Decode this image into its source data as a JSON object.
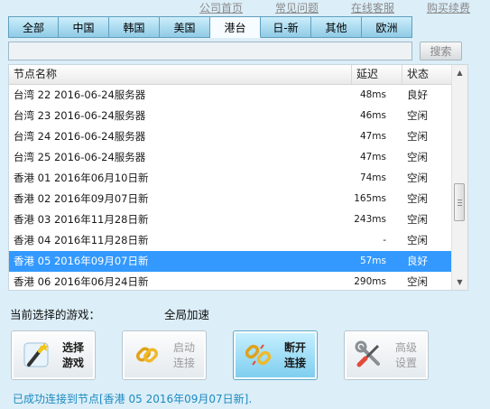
{
  "top_links": [
    "公司首页",
    "常见问题",
    "在线客服",
    "购买续费"
  ],
  "tabs": [
    "全部",
    "中国",
    "韩国",
    "美国",
    "港台",
    "日-新",
    "其他",
    "欧洲"
  ],
  "active_tab": 4,
  "search": {
    "value": "",
    "button": "搜索"
  },
  "list": {
    "headers": {
      "name": "节点名称",
      "ping": "延迟",
      "status": "状态"
    },
    "rows": [
      {
        "name": "台湾 22 2016-06-24服务器",
        "ping": "48ms",
        "status": "良好"
      },
      {
        "name": "台湾 23 2016-06-24服务器",
        "ping": "46ms",
        "status": "空闲"
      },
      {
        "name": "台湾 24 2016-06-24服务器",
        "ping": "47ms",
        "status": "空闲"
      },
      {
        "name": "台湾 25 2016-06-24服务器",
        "ping": "47ms",
        "status": "空闲"
      },
      {
        "name": "香港 01  2016年06月10日新",
        "ping": "74ms",
        "status": "空闲"
      },
      {
        "name": "香港 02 2016年09月07日新",
        "ping": "165ms",
        "status": "空闲"
      },
      {
        "name": "香港 03 2016年11月28日新",
        "ping": "243ms",
        "status": "空闲"
      },
      {
        "name": "香港 04 2016年11月28日新",
        "ping": "-",
        "status": "空闲"
      },
      {
        "name": "香港 05 2016年09月07日新",
        "ping": "57ms",
        "status": "良好"
      },
      {
        "name": "香港 06 2016年06月24日新",
        "ping": "290ms",
        "status": "空闲"
      }
    ],
    "selected_row": 8
  },
  "current_game_label": "当前选择的游戏：",
  "mode_label": "全局加速",
  "buttons": {
    "select_game": [
      "选择",
      "游戏"
    ],
    "start": [
      "启动",
      "连接"
    ],
    "disconnect": [
      "断开",
      "连接"
    ],
    "advanced": [
      "高级",
      "设置"
    ]
  },
  "status_message": "已成功连接到节点[香港 05 2016年09月07日新].",
  "colors": {
    "selection": "#3399ff",
    "status_text": "#1d8ac0",
    "background": "#dceef8"
  }
}
